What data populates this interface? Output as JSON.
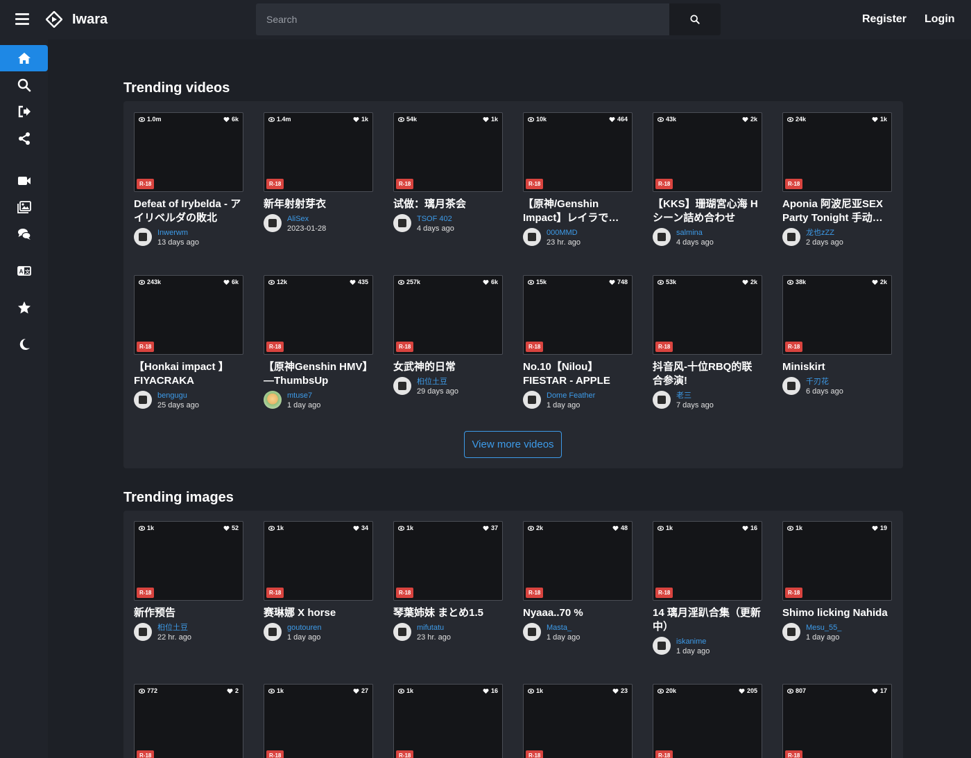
{
  "header": {
    "logo_text": "Iwara",
    "search_placeholder": "Search",
    "register_label": "Register",
    "login_label": "Login"
  },
  "sidebar": {
    "items": [
      "home-icon",
      "search-icon",
      "sign-out-icon",
      "share-icon",
      "video-icon",
      "images-icon",
      "comments-icon",
      "language-icon",
      "star-icon",
      "moon-icon"
    ]
  },
  "videos_section": {
    "title": "Trending videos",
    "view_more_label": "View more videos",
    "cards": [
      {
        "views": "1.0m",
        "likes": "6k",
        "badge": "R-18",
        "title": "Defeat of Irybelda - アイリベルダの敗北",
        "user": "Inwerwm",
        "date": "13 days ago"
      },
      {
        "views": "1.4m",
        "likes": "1k",
        "badge": "R-18",
        "title": "新年射射芽衣",
        "user": "AliSex",
        "date": "2023-01-28"
      },
      {
        "views": "54k",
        "likes": "1k",
        "badge": "R-18",
        "title": "试做：璃月茶会",
        "user": "TSOF 402",
        "date": "4 days ago"
      },
      {
        "views": "10k",
        "likes": "464",
        "badge": "R-18",
        "title": "【原神/Genshin Impact】レイラで…",
        "user": "000MMD",
        "date": "23 hr. ago"
      },
      {
        "views": "43k",
        "likes": "2k",
        "badge": "R-18",
        "title": "【KKS】珊瑚宮心海 H シーン詰め合わせ",
        "user": "salmina",
        "date": "4 days ago"
      },
      {
        "views": "24k",
        "likes": "1k",
        "badge": "R-18",
        "title": "Aponia 阿波尼亚SEX Party Tonight 手动…",
        "user": "龙也zZZ",
        "date": "2 days ago"
      },
      {
        "views": "243k",
        "likes": "6k",
        "badge": "R-18",
        "title": "【Honkai impact 】FIYACRAKA",
        "user": "bengugu",
        "date": "25 days ago"
      },
      {
        "views": "12k",
        "likes": "435",
        "badge": "R-18",
        "title": "【原神Genshin HMV】—ThumbsUp",
        "user": "mtuse7",
        "date": "1 day ago",
        "alt_avatar": true
      },
      {
        "views": "257k",
        "likes": "6k",
        "badge": "R-18",
        "title": "女武神的日常",
        "user": "桕位土豆",
        "date": "29 days ago"
      },
      {
        "views": "15k",
        "likes": "748",
        "badge": "R-18",
        "title": "No.10【Nilou】FIESTAR - APPLE PI…",
        "user": "Dome Feather",
        "date": "1 day ago"
      },
      {
        "views": "53k",
        "likes": "2k",
        "badge": "R-18",
        "title": "抖音风-十位RBQ的联合参演!",
        "user": "老三",
        "date": "7 days ago"
      },
      {
        "views": "38k",
        "likes": "2k",
        "badge": "R-18",
        "title": "Miniskirt",
        "user": "千刃花",
        "date": "6 days ago"
      }
    ]
  },
  "images_section": {
    "title": "Trending images",
    "cards": [
      {
        "views": "1k",
        "likes": "52",
        "badge": "R-18",
        "title": "新作预告",
        "user": "桕位土豆",
        "date": "22 hr. ago"
      },
      {
        "views": "1k",
        "likes": "34",
        "badge": "R-18",
        "title": "赛琳娜 X horse",
        "user": "goutouren",
        "date": "1 day ago"
      },
      {
        "views": "1k",
        "likes": "37",
        "badge": "R-18",
        "title": "琴葉姉妹 まとめ1.5",
        "user": "mifutatu",
        "date": "23 hr. ago"
      },
      {
        "views": "2k",
        "likes": "48",
        "badge": "R-18",
        "title": "Nyaaa..70 %",
        "user": "Masta_",
        "date": "1 day ago"
      },
      {
        "views": "1k",
        "likes": "16",
        "badge": "R-18",
        "title": "14 璃月淫趴合集（更新中）",
        "user": "iskanime",
        "date": "1 day ago"
      },
      {
        "views": "1k",
        "likes": "19",
        "badge": "R-18",
        "title": "Shimo licking Nahida",
        "user": "Mesu_55_",
        "date": "1 day ago"
      },
      {
        "views": "772",
        "likes": "2",
        "badge": "R-18"
      },
      {
        "views": "1k",
        "likes": "27",
        "badge": "R-18"
      },
      {
        "views": "1k",
        "likes": "16",
        "badge": "R-18"
      },
      {
        "views": "1k",
        "likes": "23",
        "badge": "R-18"
      },
      {
        "views": "20k",
        "likes": "205",
        "badge": "R-18"
      },
      {
        "views": "807",
        "likes": "17",
        "badge": "R-18"
      }
    ]
  }
}
